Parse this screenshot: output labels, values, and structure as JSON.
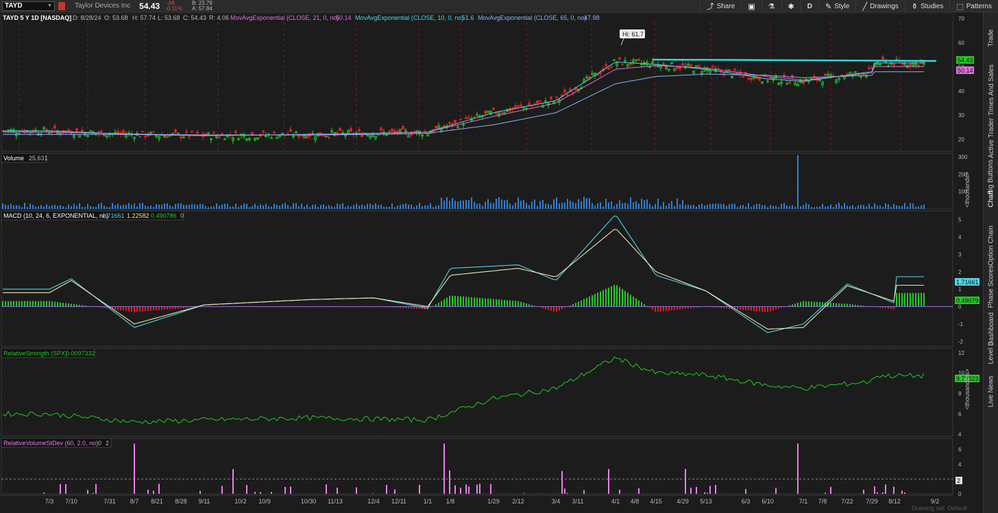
{
  "header": {
    "symbol": "TAYD",
    "company": "Taylor Devices Inc",
    "last": "54.43",
    "change": "-.06",
    "change_pct": "-0.11%",
    "bid": "B: 23.79",
    "ask": "A: 57.84"
  },
  "toolbar": {
    "share": "Share",
    "period": "D",
    "style": "Style",
    "drawings": "Drawings",
    "studies": "Studies",
    "patterns": "Patterns"
  },
  "price_panel": {
    "title": "TAYD 5 Y 1D [NASDAQ]",
    "d": "D: 8/28/24",
    "o": "O: 53.68",
    "h": "H: 57.74",
    "l": "L: 53.68",
    "c": "C: 54.43",
    "r": "R: 4.06",
    "ema21_label": "MovAvgExponential (CLOSE, 21, 0, no)",
    "ema21_val": "50.14",
    "ema10_label": "MovAvgExponential (CLOSE, 10, 0, no)",
    "ema10_val": "51.6",
    "ema65_label": "MovAvgExponential (CLOSE, 65, 0, no)",
    "ema65_val": "47.98",
    "hi_label": "Hi: 61.7",
    "price_badge": "54.43",
    "ema_badge": "50.14",
    "y_ticks": [
      "70",
      "60",
      "50",
      "40",
      "30",
      "20"
    ]
  },
  "volume_panel": {
    "title": "Volume",
    "value": "25,631",
    "y_ticks": [
      "300",
      "200",
      "100"
    ],
    "unit": "<thousands>"
  },
  "macd_panel": {
    "title": "MACD (10, 24, 6, EXPONENTIAL, no)",
    "v1": "1.71661",
    "v2": "1.22582",
    "v3": "0.490786",
    "v4": "0",
    "badge1": "1.71661",
    "badge2": "0.49079",
    "y_ticks": [
      "5",
      "4",
      "3",
      "2",
      "1",
      "0",
      "-1",
      "-2"
    ]
  },
  "rs_panel": {
    "title": "RelativeStrength (SPX)",
    "value": "0.0097332",
    "badge": "9.73323",
    "y_ticks": [
      "12",
      "10",
      "8",
      "6",
      "4"
    ],
    "unit": "<thousandths>"
  },
  "rv_panel": {
    "title": "RelativeVolumeStDev (60, 2.0, no)",
    "v1": "0",
    "v2": "2",
    "badge": "2",
    "y_ticks": [
      "6",
      "4",
      "2",
      "0"
    ]
  },
  "x_axis": [
    "7/3",
    "7/10",
    "7/31",
    "8/7",
    "8/21",
    "8/28",
    "9/11",
    "10/2",
    "10/9",
    "10/30",
    "11/13",
    "12/4",
    "12/11",
    "1/1",
    "1/8",
    "1/29",
    "2/12",
    "3/4",
    "3/11",
    "4/1",
    "4/8",
    "4/15",
    "4/29",
    "5/13",
    "6/3",
    "6/10",
    "7/1",
    "7/8",
    "7/22",
    "7/29",
    "8/12",
    "9/2"
  ],
  "footer_note": "Drawing set: Default",
  "side_tabs": [
    "Trade",
    "Times And Sales",
    "Active Trader",
    "Big Buttons",
    "Chart",
    "Option Chain",
    "Phase Scores",
    "Dashboard",
    "Level II",
    "Live News"
  ],
  "colors": {
    "up": "#22cc22",
    "down": "#e02020",
    "ema10": "#4fd8e8",
    "ema21": "#e070e0",
    "ema65": "#8ab4f8",
    "resistance": "#2fd8e0",
    "badge_green": "#22cc22",
    "badge_magenta": "#e070e0"
  },
  "chart_data": [
    {
      "type": "line",
      "title": "TAYD 5 Y 1D [NASDAQ]",
      "series": [
        {
          "name": "MovAvgExponential (CLOSE, 10, 0, no)",
          "x": [
            "7/3",
            "8/7",
            "9/11",
            "10/30",
            "12/4",
            "1/1",
            "1/29",
            "3/4",
            "4/1",
            "4/15",
            "5/13",
            "6/10",
            "7/1",
            "7/29",
            "8/28"
          ],
          "values": [
            23.5,
            22,
            21.5,
            22,
            22.5,
            23,
            31,
            36,
            52,
            51,
            49,
            45,
            44,
            48,
            51.6
          ]
        },
        {
          "name": "MovAvgExponential (CLOSE, 21, 0, no)",
          "x": [
            "7/3",
            "8/7",
            "9/11",
            "10/30",
            "12/4",
            "1/1",
            "1/29",
            "3/4",
            "4/1",
            "4/15",
            "5/13",
            "6/10",
            "7/1",
            "7/29",
            "8/28"
          ],
          "values": [
            23,
            22.2,
            21.6,
            21.9,
            22.4,
            23,
            29.5,
            35,
            49,
            50.5,
            49.5,
            46,
            44.5,
            47.5,
            50.14
          ]
        },
        {
          "name": "MovAvgExponential (CLOSE, 65, 0, no)",
          "x": [
            "7/3",
            "8/7",
            "9/11",
            "10/30",
            "12/4",
            "1/1",
            "1/29",
            "3/4",
            "4/1",
            "4/15",
            "5/13",
            "6/10",
            "7/1",
            "7/29",
            "8/28"
          ],
          "values": [
            22,
            22,
            21.8,
            21.8,
            22,
            22.5,
            26,
            31,
            43,
            46,
            47,
            46.5,
            45.5,
            46.5,
            47.98
          ]
        }
      ],
      "annotations": [
        "Hi: 61.7"
      ],
      "ylim": [
        15,
        72
      ]
    },
    {
      "type": "bar",
      "title": "Volume",
      "ylim": [
        0,
        320
      ],
      "note": "values in thousands; spike near 6/28 ~310"
    },
    {
      "type": "line",
      "title": "MACD (10, 24, 6, EXPONENTIAL, no)",
      "series": [
        {
          "name": "MACD",
          "x": [
            "7/3",
            "7/10",
            "8/7",
            "9/11",
            "10/30",
            "12/4",
            "1/1",
            "1/8",
            "2/12",
            "3/4",
            "4/1",
            "4/15",
            "5/13",
            "6/10",
            "7/1",
            "7/22",
            "8/12",
            "8/28"
          ],
          "values": [
            1,
            1.6,
            -1.2,
            0.1,
            0.4,
            0.5,
            -0.1,
            2.2,
            2.4,
            1.5,
            5.3,
            1.8,
            0.9,
            -1.5,
            -1.0,
            1.3,
            0.2,
            1.71661
          ]
        },
        {
          "name": "Avg",
          "x": [
            "7/3",
            "7/10",
            "8/7",
            "9/11",
            "10/30",
            "12/4",
            "1/1",
            "1/8",
            "2/12",
            "3/4",
            "4/1",
            "4/15",
            "5/13",
            "6/10",
            "7/1",
            "7/22",
            "8/12",
            "8/28"
          ],
          "values": [
            0.8,
            1.5,
            -1.0,
            0.1,
            0.4,
            0.5,
            0.0,
            1.8,
            2.2,
            1.7,
            4.5,
            2.0,
            0.9,
            -1.3,
            -1.2,
            1.2,
            0.3,
            1.22582
          ]
        }
      ],
      "ylim": [
        -2.3,
        5.5
      ]
    },
    {
      "type": "line",
      "title": "RelativeStrength (SPX)",
      "series": [
        {
          "name": "RelativeStrength (SPX)",
          "x": [
            "7/3",
            "8/7",
            "9/11",
            "10/30",
            "12/4",
            "1/1",
            "1/29",
            "3/4",
            "4/1",
            "4/15",
            "5/13",
            "6/10",
            "7/1",
            "7/29",
            "8/28"
          ],
          "values": [
            6.0,
            5.2,
            5.4,
            5.6,
            5.5,
            5.4,
            7.5,
            8.5,
            11.5,
            10.0,
            9.8,
            8.8,
            8.5,
            9.2,
            9.73323
          ]
        }
      ],
      "ylim": [
        3.8,
        12.4
      ]
    },
    {
      "type": "bar",
      "title": "RelativeVolumeStDev (60, 2.0, no)",
      "ylim": [
        0,
        7.5
      ]
    }
  ]
}
